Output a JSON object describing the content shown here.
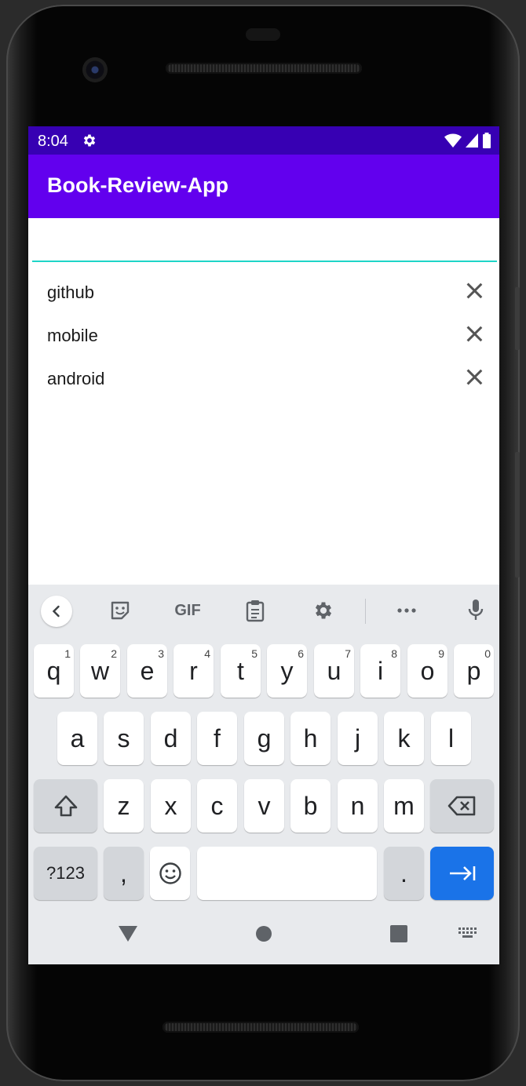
{
  "status_bar": {
    "time": "8:04"
  },
  "app_bar": {
    "title": "Book-Review-App"
  },
  "search": {
    "value": "",
    "placeholder": ""
  },
  "history": [
    {
      "label": "github"
    },
    {
      "label": "mobile"
    },
    {
      "label": "android"
    }
  ],
  "keyboard": {
    "toolbar": {
      "gif_label": "GIF"
    },
    "row1": [
      {
        "k": "q",
        "h": "1"
      },
      {
        "k": "w",
        "h": "2"
      },
      {
        "k": "e",
        "h": "3"
      },
      {
        "k": "r",
        "h": "4"
      },
      {
        "k": "t",
        "h": "5"
      },
      {
        "k": "y",
        "h": "6"
      },
      {
        "k": "u",
        "h": "7"
      },
      {
        "k": "i",
        "h": "8"
      },
      {
        "k": "o",
        "h": "9"
      },
      {
        "k": "p",
        "h": "0"
      }
    ],
    "row2": [
      "a",
      "s",
      "d",
      "f",
      "g",
      "h",
      "j",
      "k",
      "l"
    ],
    "row3": [
      "z",
      "x",
      "c",
      "v",
      "b",
      "n",
      "m"
    ],
    "symbols_label": "?123",
    "comma_label": ",",
    "period_label": "."
  },
  "colors": {
    "status_bar": "#3700b3",
    "app_bar": "#6200ee",
    "input_underline": "#1ed5c8",
    "action_key": "#1a73e8"
  }
}
